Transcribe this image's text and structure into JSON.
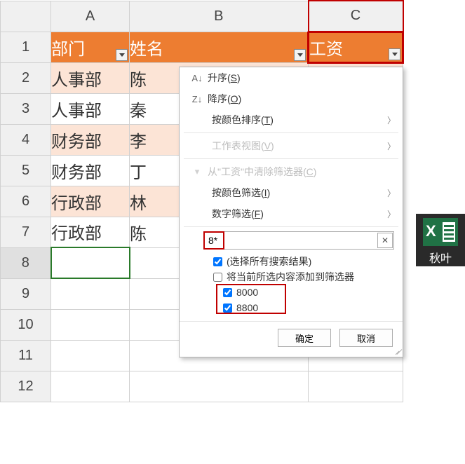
{
  "columns": {
    "A": "A",
    "B": "B",
    "C": "C"
  },
  "rows": [
    "1",
    "2",
    "3",
    "4",
    "5",
    "6",
    "7",
    "8",
    "9",
    "10",
    "11",
    "12"
  ],
  "header": {
    "dept": "部门",
    "name": "姓名",
    "salary": "工资"
  },
  "data": [
    {
      "dept": "人事部",
      "name": "陈"
    },
    {
      "dept": "人事部",
      "name": "秦"
    },
    {
      "dept": "财务部",
      "name": "李"
    },
    {
      "dept": "财务部",
      "name": "丁"
    },
    {
      "dept": "行政部",
      "name": "林"
    },
    {
      "dept": "行政部",
      "name": "陈"
    }
  ],
  "menu": {
    "sort_asc": "升序(S)",
    "sort_desc": "降序(O)",
    "sort_color": "按颜色排序(T)",
    "sheet_view": "工作表视图(V)",
    "clear_filter": "从\"工资\"中清除筛选器(C)",
    "filter_color": "按颜色筛选(I)",
    "filter_number": "数字筛选(F)",
    "search_value": "8*",
    "select_all": "(选择所有搜索结果)",
    "add_current": "将当前所选内容添加到筛选器",
    "results": [
      "8000",
      "8800"
    ],
    "ok": "确定",
    "cancel": "取消"
  },
  "badge": {
    "text": "秋叶",
    "icon_letter": "X"
  }
}
